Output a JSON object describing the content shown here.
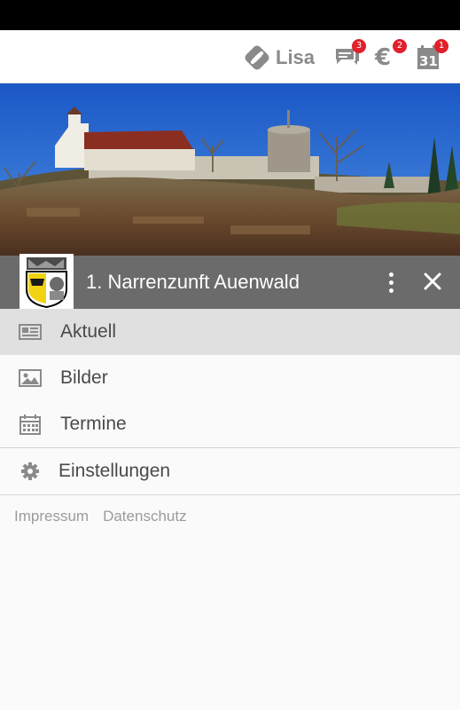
{
  "topbar": {
    "user_name": "Lisa",
    "messages_badge": "3",
    "payments_badge": "2",
    "calendar_badge": "1",
    "euro_symbol": "€",
    "calendar_day": "31"
  },
  "organization": {
    "name": "1. Narrenzunft Auenwald"
  },
  "menu": {
    "items": [
      {
        "label": "Aktuell",
        "icon": "newspaper-icon",
        "active": true
      },
      {
        "label": "Bilder",
        "icon": "image-icon",
        "active": false
      },
      {
        "label": "Termine",
        "icon": "calendar-icon",
        "active": false
      }
    ],
    "settings_label": "Einstellungen"
  },
  "footer": {
    "impressum": "Impressum",
    "datenschutz": "Datenschutz"
  },
  "colors": {
    "org_bar": "#6b6b6b",
    "badge": "#e0202a",
    "active_item": "#e0e0e0"
  }
}
